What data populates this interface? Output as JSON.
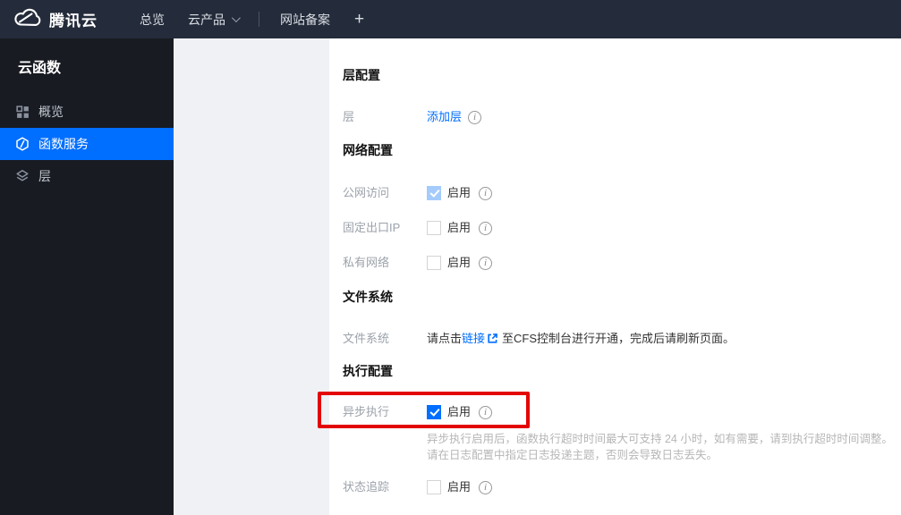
{
  "colors": {
    "accent": "#006eff",
    "topbar_bg": "#242b3a",
    "sidebar_bg": "#181b22",
    "active_item_bg": "#006eff",
    "highlight_annotation": "#e30505",
    "checked_disabled_checkbox": "#a4cbfb"
  },
  "topbar": {
    "brand": "腾讯云",
    "nav": [
      {
        "label": "总览"
      },
      {
        "label": "云产品",
        "has_dropdown": true
      },
      {
        "label": "网站备案"
      }
    ],
    "plus_label": "+"
  },
  "sidebar": {
    "title": "云函数",
    "items": [
      {
        "label": "概览",
        "icon": "grid-icon",
        "active": false
      },
      {
        "label": "函数服务",
        "icon": "function-icon",
        "active": true
      },
      {
        "label": "层",
        "icon": "layers-icon",
        "active": false
      }
    ]
  },
  "content": {
    "layer_config": {
      "title": "层配置",
      "row": {
        "label": "层",
        "link": "添加层"
      }
    },
    "network_config": {
      "title": "网络配置",
      "rows": [
        {
          "label": "公网访问",
          "value": "启用",
          "checkbox_state": "checked-disabled"
        },
        {
          "label": "固定出口IP",
          "value": "启用",
          "checkbox_state": "unchecked"
        },
        {
          "label": "私有网络",
          "value": "启用",
          "checkbox_state": "unchecked"
        }
      ]
    },
    "file_system": {
      "title": "文件系统",
      "row": {
        "label": "文件系统",
        "text_before": "请点击",
        "link": "链接",
        "text_after": "至CFS控制台进行开通，完成后请刷新页面。"
      }
    },
    "execution_config": {
      "title": "执行配置",
      "async_row": {
        "label": "异步执行",
        "value": "启用",
        "checkbox_state": "checked"
      },
      "description_line1": "异步执行启用后，函数执行超时时间最大可支持 24 小时，如有需要，请到执行超时时间调整。",
      "description_line2": "请在日志配置中指定日志投递主题，否则会导致日志丢失。",
      "status_row": {
        "label": "状态追踪",
        "value": "启用",
        "checkbox_state": "unchecked"
      }
    }
  },
  "icons": {
    "info_glyph": "i"
  }
}
